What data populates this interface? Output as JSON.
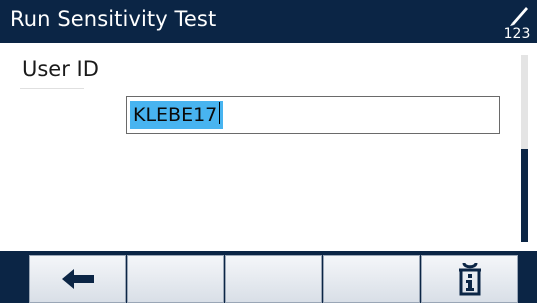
{
  "title_bar": {
    "title": "Run Sensitivity Test",
    "input_mode_label": "123",
    "input_mode_icon": "numeric-input-mode-icon"
  },
  "form": {
    "field_label": "User ID",
    "field_value": "KLEBE17"
  },
  "softkeys": [
    {
      "icon": "back-arrow-icon"
    },
    {
      "icon": ""
    },
    {
      "icon": ""
    },
    {
      "icon": ""
    },
    {
      "icon": "info-icon"
    }
  ],
  "colors": {
    "header_bg": "#0b2545",
    "selection_highlight": "#48b4f0",
    "softkey_bg": "#e6ebf1"
  }
}
